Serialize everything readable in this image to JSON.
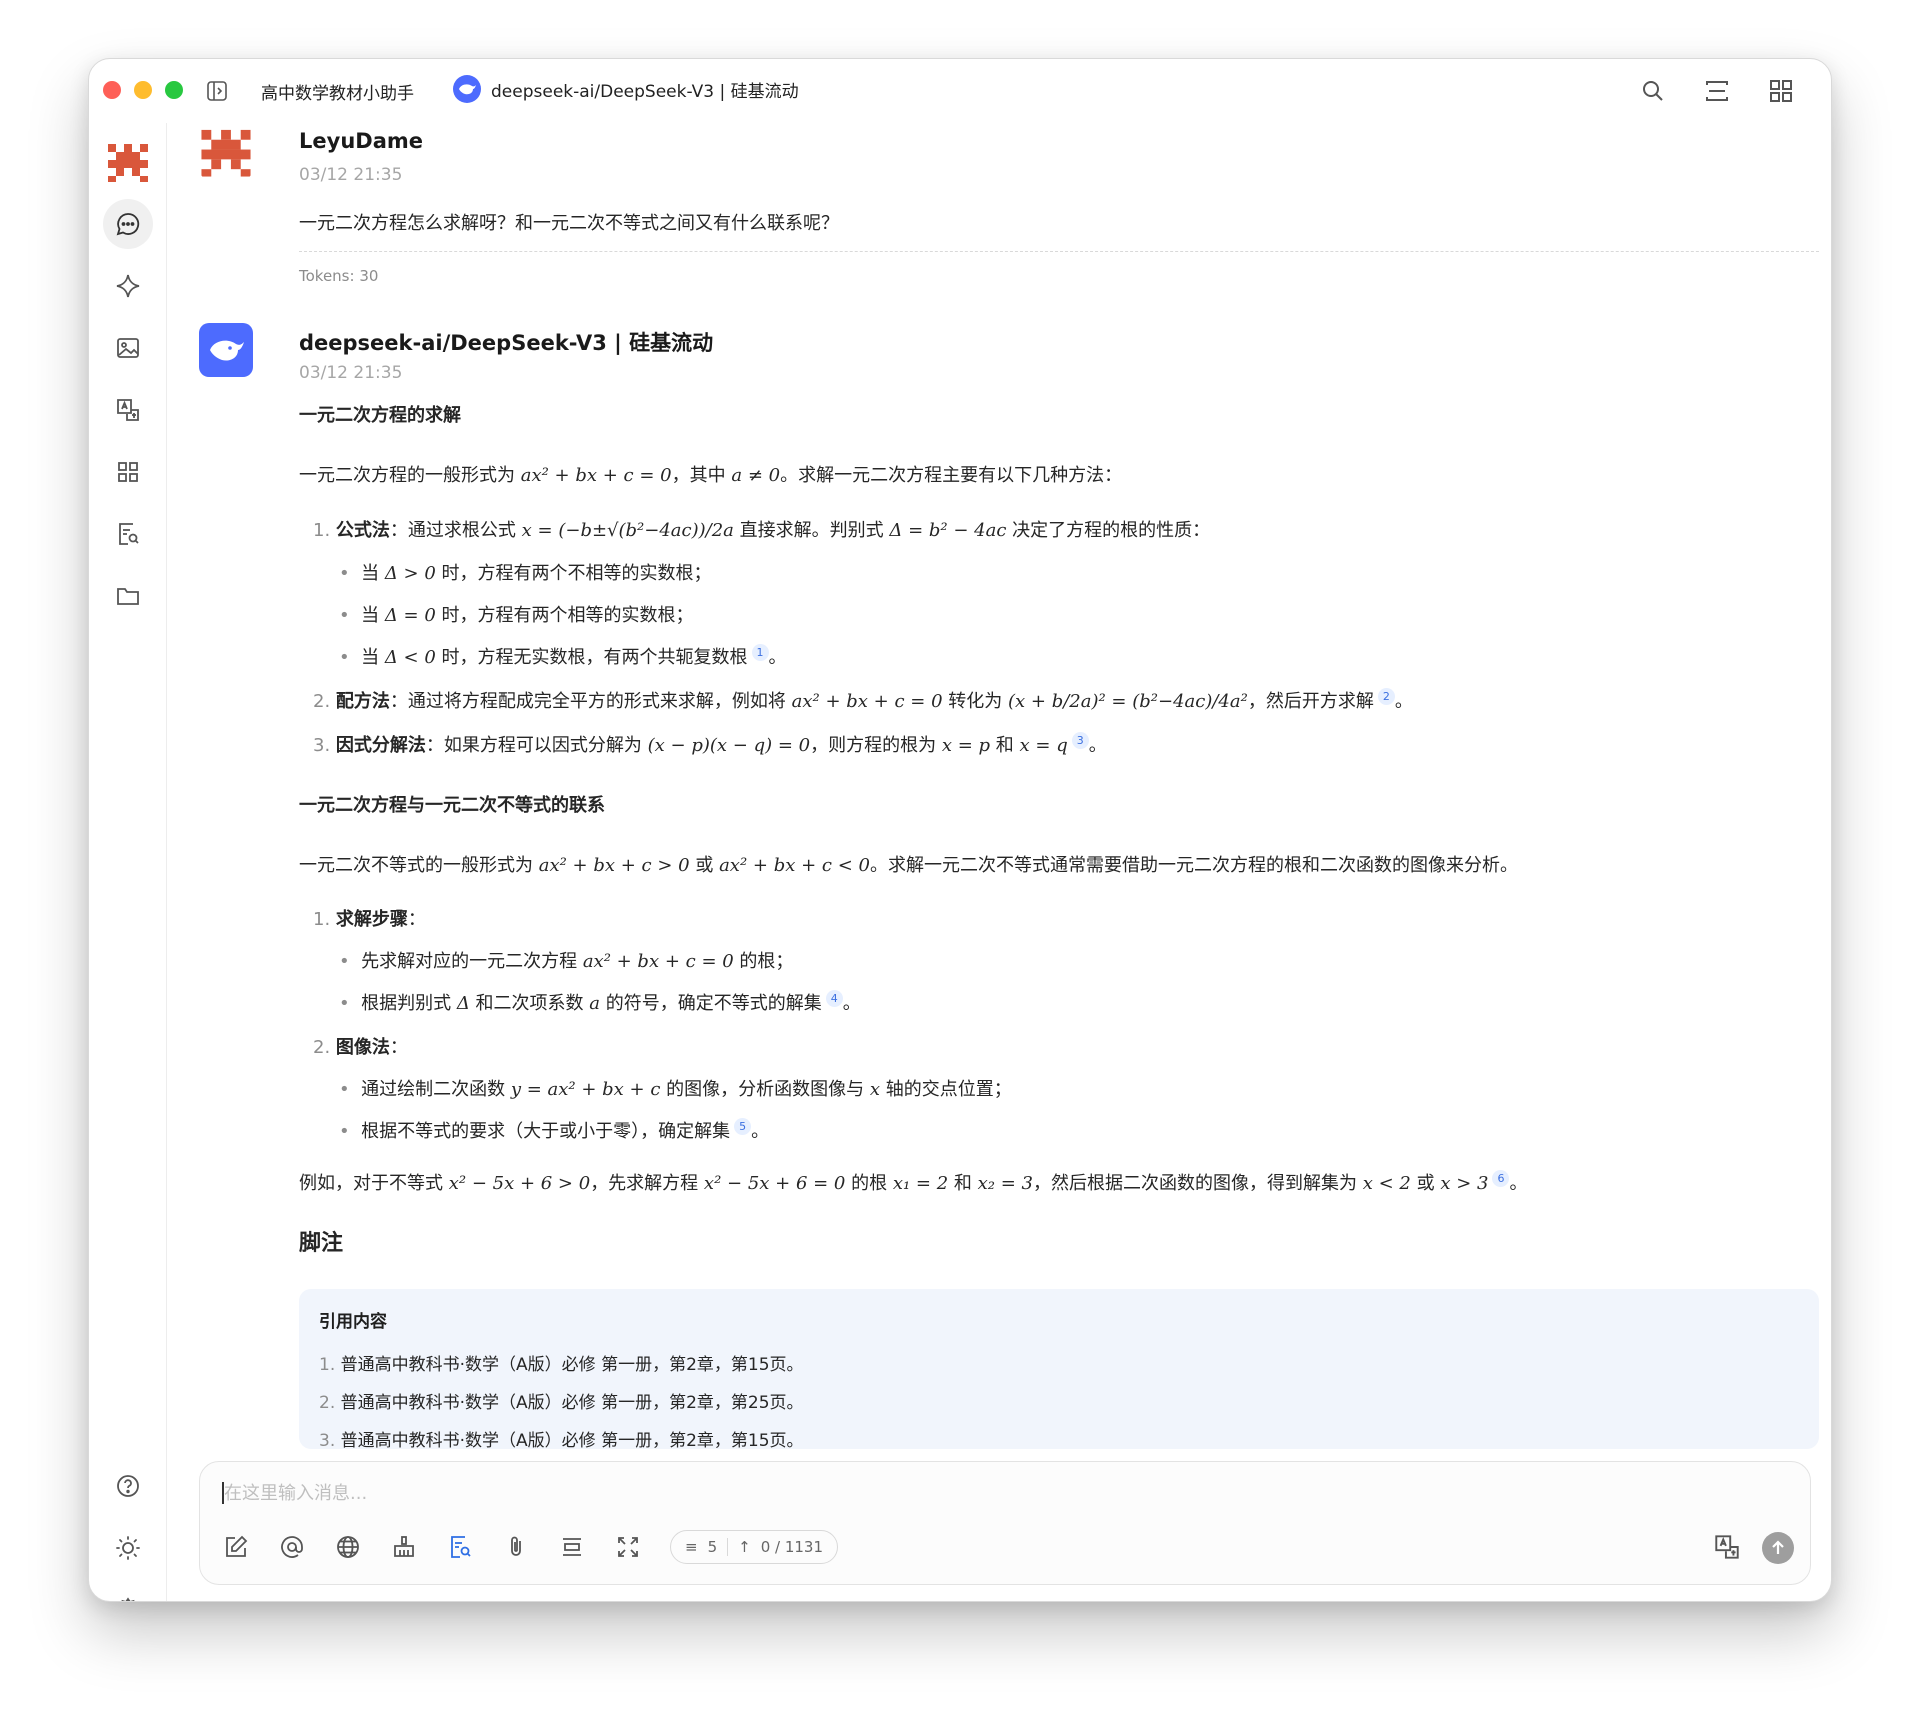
{
  "titlebar": {
    "assistant_name": "高中数学教材小助手",
    "model_name": "deepseek-ai/DeepSeek-V3 | 硅基流动"
  },
  "user_msg": {
    "author": "LeyuDame",
    "time": "03/12 21:35",
    "text": "一元二次方程怎么求解呀？和一元二次不等式之间又有什么联系呢？",
    "tokens": "Tokens: 30"
  },
  "ai_msg": {
    "author": "deepseek-ai/DeepSeek-V3 | 硅基流动",
    "time": "03/12 21:35",
    "h_solve": "一元二次方程的求解",
    "intro_a": "一元二次方程的一般形式为 ",
    "intro_math1": "ax² + bx + c = 0",
    "intro_b": "，其中 ",
    "intro_math2": "a ≠ 0",
    "intro_c": "。求解一元二次方程主要有以下几种方法：",
    "m1_num": "1.",
    "m1_title": "公式法",
    "m1_a": "：通过求根公式 ",
    "m1_formula": "x = (−b±√(b²−4ac))/2a",
    "m1_b": " 直接求解。判别式 ",
    "m1_disc": "Δ = b² − 4ac",
    "m1_c": " 决定了方程的根的性质：",
    "b1_math": "Δ > 0",
    "b1_text": " 时，方程有两个不相等的实数根；",
    "b2_math": "Δ = 0",
    "b2_text": " 时，方程有两个相等的实数根；",
    "b3_math": "Δ < 0",
    "b3_text": " 时，方程无实数根，有两个共轭复数根",
    "bullet_prefix": "当 ",
    "m2_num": "2.",
    "m2_title": "配方法",
    "m2_a": "：通过将方程配成完全平方的形式来求解，例如将 ",
    "m2_math1": "ax² + bx + c = 0",
    "m2_b": " 转化为 ",
    "m2_math2": "(x + b/2a)² = (b²−4ac)/4a²",
    "m2_c": "，然后开方求解",
    "m3_num": "3.",
    "m3_title": "因式分解法",
    "m3_a": "：如果方程可以因式分解为 ",
    "m3_math1": "(x − p)(x − q) = 0",
    "m3_b": "，则方程的根为 ",
    "m3_math2": "x = p",
    "m3_c": " 和 ",
    "m3_math3": "x = q",
    "h_relation": "一元二次方程与一元二次不等式的联系",
    "rel_a": "一元二次不等式的一般形式为 ",
    "rel_math1": "ax² + bx + c > 0",
    "rel_b": " 或 ",
    "rel_math2": "ax² + bx + c < 0",
    "rel_c": "。求解一元二次不等式通常需要借助一元二次方程的根和二次函数的图像来分析。",
    "s1_num": "1.",
    "s1_title": "求解步骤",
    "s1_b1_a": "先求解对应的一元二次方程 ",
    "s1_b1_math": "ax² + bx + c = 0",
    "s1_b1_b": " 的根；",
    "s1_b2_a": "根据判别式 ",
    "s1_b2_math1": "Δ",
    "s1_b2_b": " 和二次项系数 ",
    "s1_b2_math2": "a",
    "s1_b2_c": " 的符号，确定不等式的解集",
    "s2_num": "2.",
    "s2_title": "图像法",
    "s2_b1_a": "通过绘制二次函数 ",
    "s2_b1_math1": "y = ax² + bx + c",
    "s2_b1_b": " 的图像，分析函数图像与 ",
    "s2_b1_math2": "x",
    "s2_b1_c": " 轴的交点位置；",
    "s2_b2": "根据不等式的要求（大于或小于零），确定解集",
    "ex_a": "例如，对于不等式 ",
    "ex_math1": "x² − 5x + 6 > 0",
    "ex_b": "，先求解方程 ",
    "ex_math2": "x² − 5x + 6 = 0",
    "ex_c": " 的根 ",
    "ex_math3": "x₁ = 2",
    "ex_d": " 和 ",
    "ex_math4": "x₂ = 3",
    "ex_e": "，然后根据二次函数的图像，得到解集为 ",
    "ex_math5": "x < 2",
    "ex_f": " 或 ",
    "ex_math6": "x > 3",
    "period": "。",
    "colon": "：",
    "h_footnote": "脚注",
    "cites": [
      "1",
      "2",
      "3",
      "4",
      "5",
      "6"
    ],
    "refs_title": "引用内容",
    "refs": [
      {
        "num": "1.",
        "text": "普通高中教科书·数学（A版）必修 第一册，第2章，第15页。"
      },
      {
        "num": "2.",
        "text": "普通高中教科书·数学（A版）必修 第一册，第2章，第25页。"
      },
      {
        "num": "3.",
        "text": "普通高中教科书·数学（A版）必修 第一册，第2章，第15页。"
      }
    ]
  },
  "input": {
    "placeholder": "在这里输入消息...",
    "context_count": "5",
    "token_count": "0 / 1131"
  },
  "colors": {
    "accent": "#4d6bfe",
    "user_avatar": "#d9573b",
    "citation_bg": "#e6efff",
    "ref_box_bg": "#f1f5fc"
  }
}
